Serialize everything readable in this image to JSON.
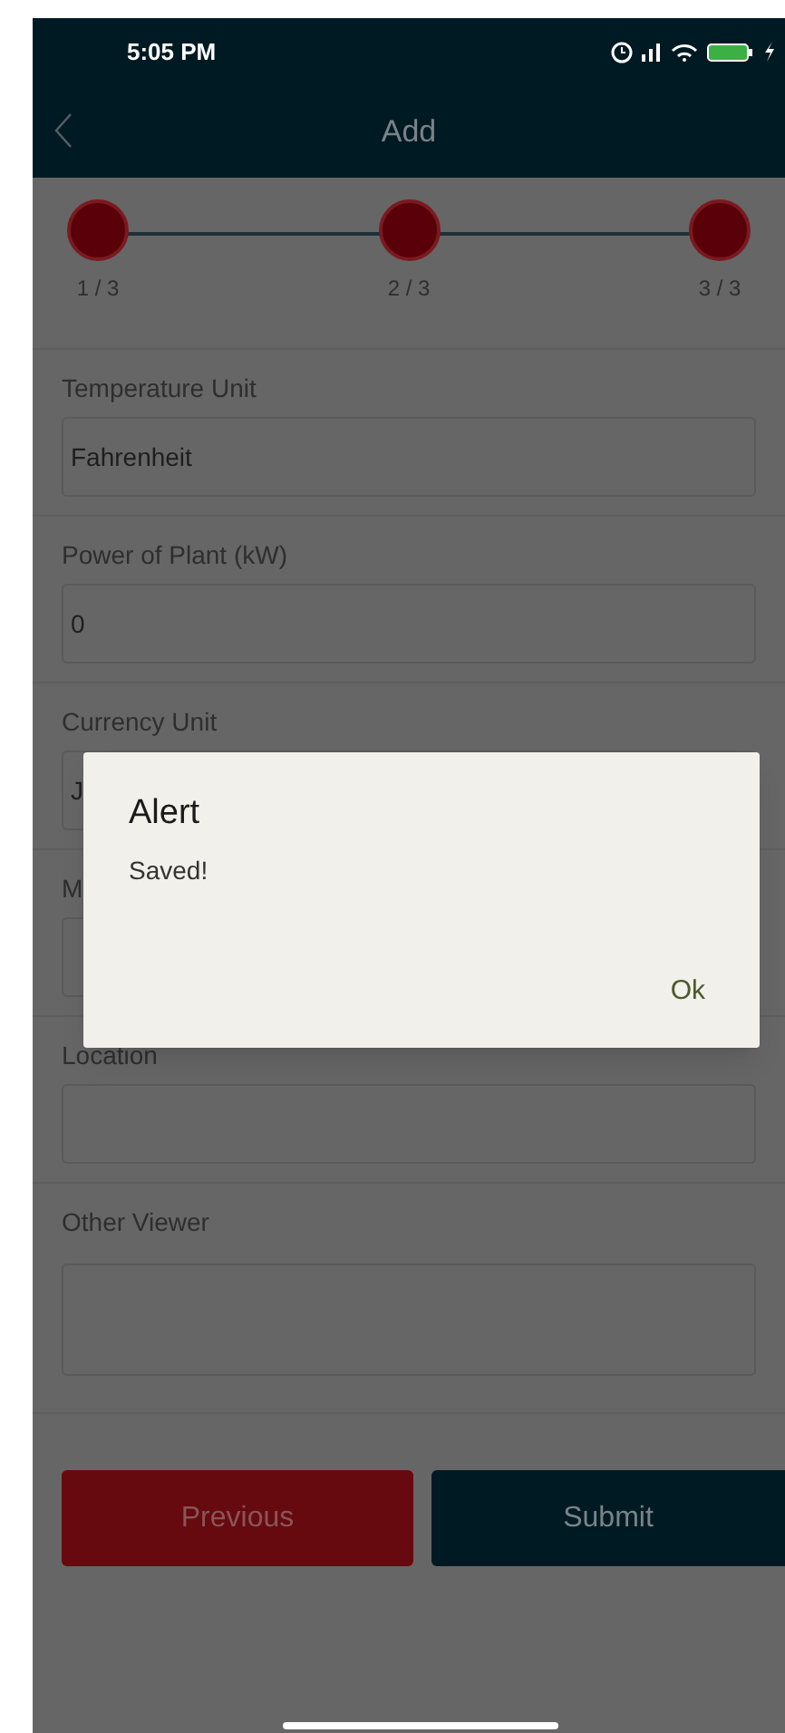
{
  "status_bar": {
    "time": "5:05 PM"
  },
  "nav": {
    "title": "Add"
  },
  "steps": [
    {
      "label": "1 / 3"
    },
    {
      "label": "2 / 3"
    },
    {
      "label": "3 / 3"
    }
  ],
  "fields": [
    {
      "label": "Temperature Unit",
      "value": "Fahrenheit",
      "kind": "input"
    },
    {
      "label": "Power of Plant (kW)",
      "value": "0",
      "kind": "input"
    },
    {
      "label": "Currency Unit",
      "value": "J",
      "kind": "input"
    },
    {
      "label": "M",
      "kind": "input"
    },
    {
      "label": "Location",
      "kind": "input"
    },
    {
      "label": "Other Viewer",
      "kind": "textarea"
    }
  ],
  "buttons": [
    {
      "label": "Previous",
      "kind": "secondary"
    },
    {
      "label": "Submit",
      "kind": "primary"
    }
  ],
  "dialog": {
    "title": "Alert",
    "message": "Saved!",
    "action": "Ok"
  }
}
